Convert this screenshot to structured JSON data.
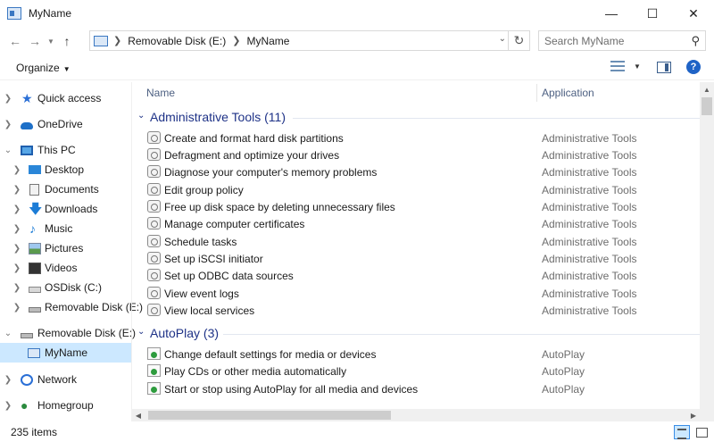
{
  "window": {
    "title": "MyName",
    "minimize_icon": "minimize-icon",
    "maximize_icon": "maximize-icon",
    "close_icon": "close-icon"
  },
  "address_bar": {
    "breadcrumbs": [
      "Removable Disk (E:)",
      "MyName"
    ],
    "search_placeholder": "Search MyName"
  },
  "command_bar": {
    "organize_label": "Organize"
  },
  "nav_pane": {
    "items": [
      {
        "label": "Quick access",
        "icon": "quick-access-star-icon"
      },
      {
        "label": "OneDrive",
        "icon": "onedrive-cloud-icon"
      },
      {
        "label": "This PC",
        "icon": "this-pc-icon"
      },
      {
        "label": "Desktop",
        "icon": "desktop-icon"
      },
      {
        "label": "Documents",
        "icon": "documents-icon"
      },
      {
        "label": "Downloads",
        "icon": "downloads-icon"
      },
      {
        "label": "Music",
        "icon": "music-icon"
      },
      {
        "label": "Pictures",
        "icon": "pictures-icon"
      },
      {
        "label": "Videos",
        "icon": "videos-icon"
      },
      {
        "label": "OSDisk (C:)",
        "icon": "disk-drive-icon"
      },
      {
        "label": "Removable Disk (E:)",
        "icon": "removable-disk-icon"
      },
      {
        "label": "Removable Disk (E:)",
        "icon": "removable-disk-icon"
      },
      {
        "label": "MyName",
        "icon": "folder-icon"
      },
      {
        "label": "Network",
        "icon": "network-icon"
      },
      {
        "label": "Homegroup",
        "icon": "homegroup-icon"
      }
    ]
  },
  "columns": {
    "name": "Name",
    "application": "Application"
  },
  "groups": [
    {
      "title": "Administrative Tools (11)",
      "items": [
        {
          "name": "Create and format hard disk partitions",
          "app": "Administrative Tools"
        },
        {
          "name": "Defragment and optimize your drives",
          "app": "Administrative Tools"
        },
        {
          "name": "Diagnose your computer's memory problems",
          "app": "Administrative Tools"
        },
        {
          "name": "Edit group policy",
          "app": "Administrative Tools"
        },
        {
          "name": "Free up disk space by deleting unnecessary files",
          "app": "Administrative Tools"
        },
        {
          "name": "Manage computer certificates",
          "app": "Administrative Tools"
        },
        {
          "name": "Schedule tasks",
          "app": "Administrative Tools"
        },
        {
          "name": "Set up iSCSI initiator",
          "app": "Administrative Tools"
        },
        {
          "name": "Set up ODBC data sources",
          "app": "Administrative Tools"
        },
        {
          "name": "View event logs",
          "app": "Administrative Tools"
        },
        {
          "name": "View local services",
          "app": "Administrative Tools"
        }
      ]
    },
    {
      "title": "AutoPlay (3)",
      "items": [
        {
          "name": "Change default settings for media or devices",
          "app": "AutoPlay"
        },
        {
          "name": "Play CDs or other media automatically",
          "app": "AutoPlay"
        },
        {
          "name": "Start or stop using AutoPlay for all media and devices",
          "app": "AutoPlay"
        }
      ]
    }
  ],
  "status_bar": {
    "item_count": "235 items"
  },
  "colors": {
    "selection": "#cce8ff",
    "group_header": "#1e3287",
    "accent": "#1f63c6"
  }
}
